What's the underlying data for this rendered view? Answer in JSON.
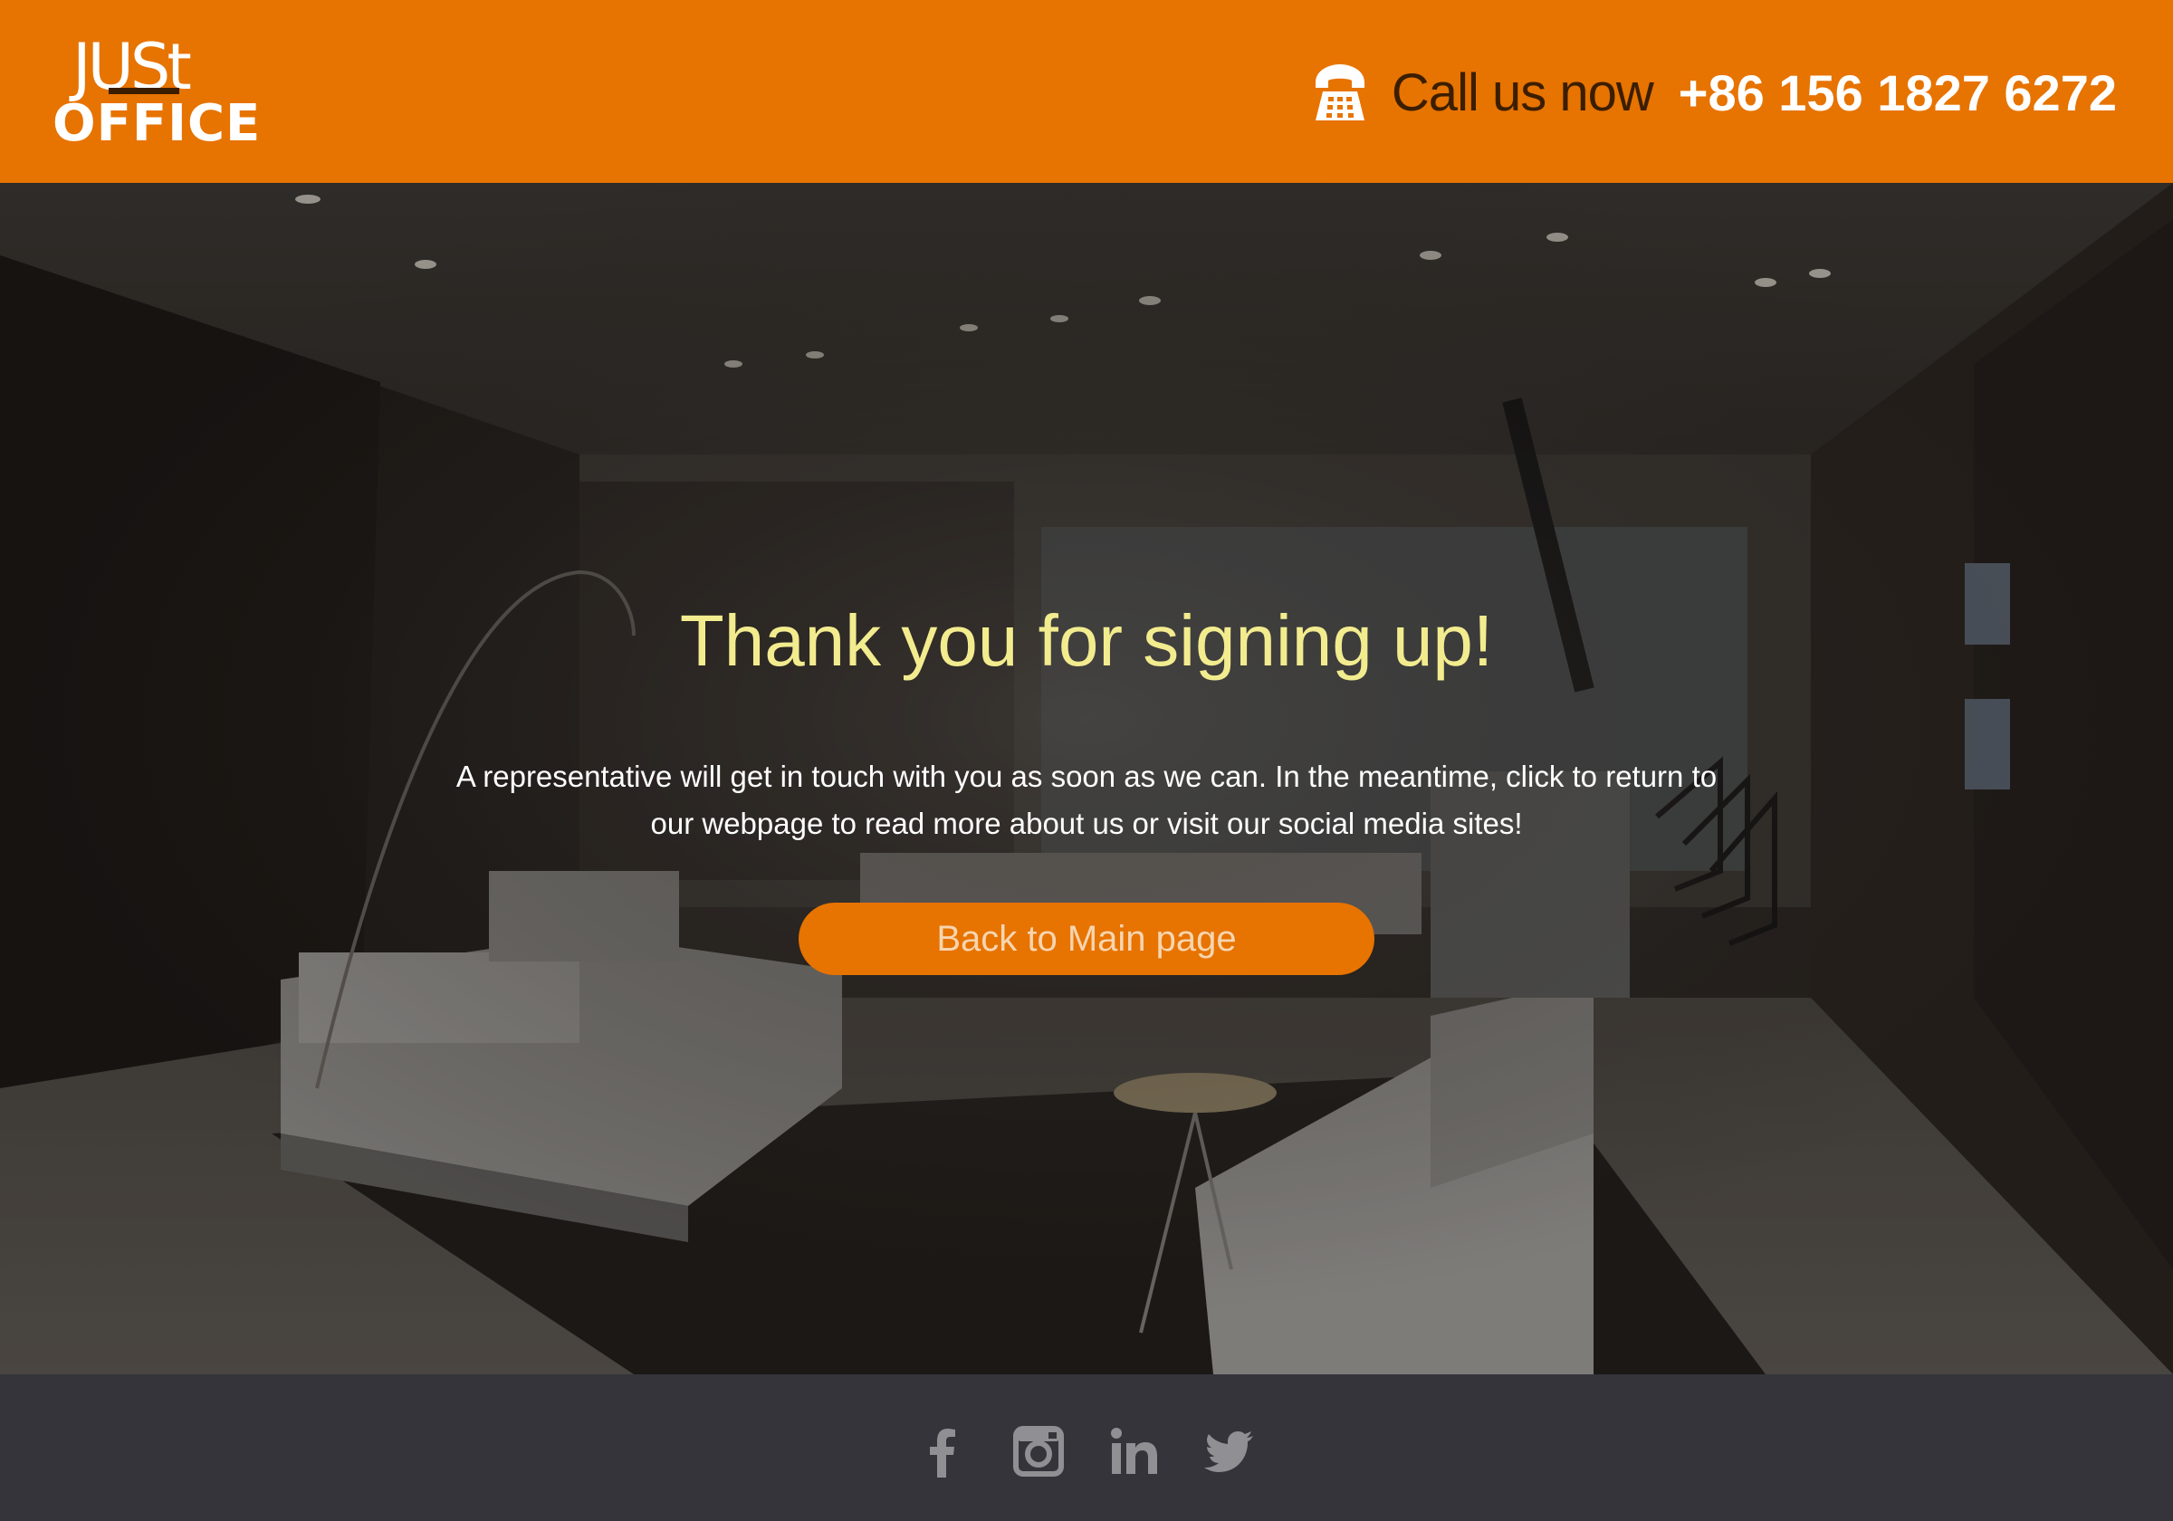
{
  "brand": {
    "logo_top": "JUSt",
    "logo_bottom": "OFFICE"
  },
  "header": {
    "call_label": "Call us now",
    "phone_number": "+86 156 1827 6272",
    "icon": "telephone-icon",
    "background_color": "#e77300"
  },
  "hero": {
    "title": "Thank you for signing up!",
    "message": "A representative will get in touch with you as soon as we can. In the meantime, click to return to our webpage to read more about us or visit our social media sites!",
    "button_label": "Back to Main page",
    "title_color": "#f3ec8f",
    "button_color": "#e77300"
  },
  "footer": {
    "social_icons": [
      "facebook-icon",
      "instagram-icon",
      "linkedin-icon",
      "twitter-icon"
    ],
    "icon_color": "#8f8f94",
    "background_color": "#34343a"
  }
}
